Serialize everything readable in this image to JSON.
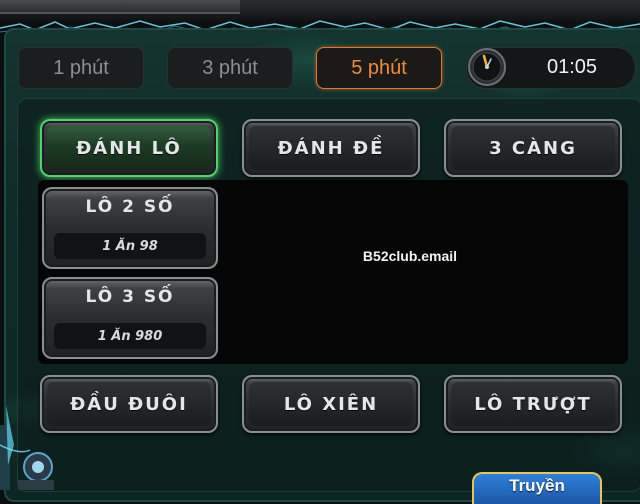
{
  "time_tabs": [
    {
      "label": "1 phút",
      "active": false
    },
    {
      "label": "3 phút",
      "active": false
    },
    {
      "label": "5 phút",
      "active": true
    }
  ],
  "timer": {
    "value": "01:05",
    "icon": "clock-icon"
  },
  "bet_types": [
    {
      "label": "ĐÁNH LÔ",
      "active": true
    },
    {
      "label": "ĐÁNH ĐỀ",
      "active": false
    },
    {
      "label": "3 CÀNG",
      "active": false
    }
  ],
  "options": [
    {
      "title": "LÔ 2 SỐ",
      "rate": "1 Ăn 98"
    },
    {
      "title": "LÔ 3 SỐ",
      "rate": "1 Ăn 980"
    }
  ],
  "watermark": "B52club.email",
  "bottom_modes": [
    {
      "label": "ĐẦU ĐUÔI"
    },
    {
      "label": "LÔ XIÊN"
    },
    {
      "label": "LÔ TRƯỢT"
    }
  ],
  "corner_button": {
    "label": "Truyền"
  },
  "colors": {
    "active_tab": "#f08a35",
    "active_button_glow": "#4fd36b",
    "panel_teal": "#143430",
    "corner_button_blue": "#2f7fd8"
  }
}
